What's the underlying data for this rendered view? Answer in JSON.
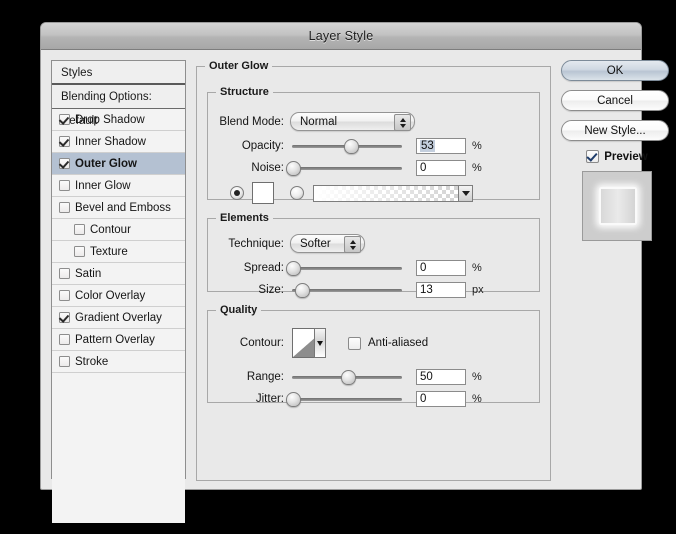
{
  "window": {
    "title": "Layer Style"
  },
  "styles_panel": {
    "header": "Styles",
    "blending_options": "Blending Options: Default",
    "items": [
      {
        "label": "Drop Shadow",
        "checked": true,
        "indent": false,
        "selected": false
      },
      {
        "label": "Inner Shadow",
        "checked": true,
        "indent": false,
        "selected": false
      },
      {
        "label": "Outer Glow",
        "checked": true,
        "indent": false,
        "selected": true
      },
      {
        "label": "Inner Glow",
        "checked": false,
        "indent": false,
        "selected": false
      },
      {
        "label": "Bevel and Emboss",
        "checked": false,
        "indent": false,
        "selected": false
      },
      {
        "label": "Contour",
        "checked": false,
        "indent": true,
        "selected": false
      },
      {
        "label": "Texture",
        "checked": false,
        "indent": true,
        "selected": false
      },
      {
        "label": "Satin",
        "checked": false,
        "indent": false,
        "selected": false
      },
      {
        "label": "Color Overlay",
        "checked": false,
        "indent": false,
        "selected": false
      },
      {
        "label": "Gradient Overlay",
        "checked": true,
        "indent": false,
        "selected": false
      },
      {
        "label": "Pattern Overlay",
        "checked": false,
        "indent": false,
        "selected": false
      },
      {
        "label": "Stroke",
        "checked": false,
        "indent": false,
        "selected": false
      }
    ]
  },
  "panel": {
    "title": "Outer Glow",
    "structure": {
      "legend": "Structure",
      "blend_mode_label": "Blend Mode:",
      "blend_mode_value": "Normal",
      "opacity_label": "Opacity:",
      "opacity_value": "53",
      "opacity_unit": "%",
      "opacity_percent": 53,
      "noise_label": "Noise:",
      "noise_value": "0",
      "noise_unit": "%",
      "noise_percent": 0,
      "fill_color_selected": true,
      "fill_gradient_selected": false,
      "color_swatch": "#ffffff"
    },
    "elements": {
      "legend": "Elements",
      "technique_label": "Technique:",
      "technique_value": "Softer",
      "spread_label": "Spread:",
      "spread_value": "0",
      "spread_unit": "%",
      "spread_percent": 0,
      "size_label": "Size:",
      "size_value": "13",
      "size_unit": "px",
      "size_percent": 9
    },
    "quality": {
      "legend": "Quality",
      "contour_label": "Contour:",
      "anti_aliased_label": "Anti-aliased",
      "anti_aliased_checked": false,
      "range_label": "Range:",
      "range_value": "50",
      "range_unit": "%",
      "range_percent": 50,
      "jitter_label": "Jitter:",
      "jitter_value": "0",
      "jitter_unit": "%",
      "jitter_percent": 0
    }
  },
  "actions": {
    "ok": "OK",
    "cancel": "Cancel",
    "new_style": "New Style...",
    "preview_label": "Preview",
    "preview_checked": true
  }
}
